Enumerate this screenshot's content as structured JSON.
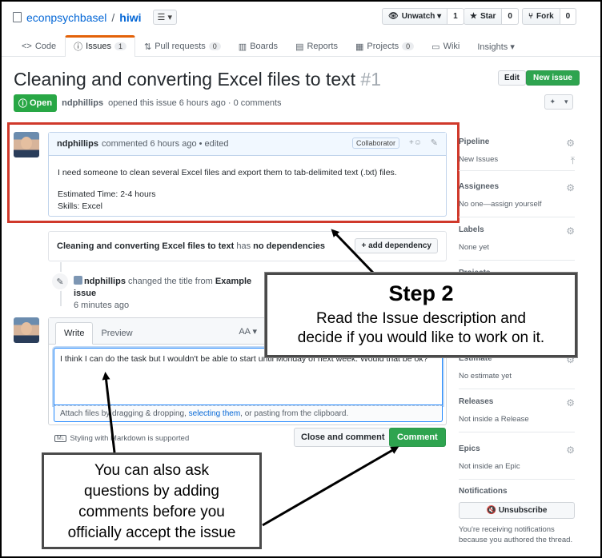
{
  "repo": {
    "owner": "econpsychbasel",
    "separator": "/",
    "name": "hiwi",
    "list_btn": "☰ ▾"
  },
  "actions": [
    {
      "label": "Unwatch ▾",
      "icon": "eye-icon",
      "count": "1"
    },
    {
      "label": "Star",
      "icon": "star-icon",
      "count": "0"
    },
    {
      "label": "Fork",
      "icon": "fork-icon",
      "count": "0"
    }
  ],
  "tabs": [
    {
      "label": "Code",
      "icon": "<>",
      "count": ""
    },
    {
      "label": "Issues",
      "icon": "ⓘ",
      "count": "1"
    },
    {
      "label": "Pull requests",
      "icon": "⇅",
      "count": "0"
    },
    {
      "label": "Boards",
      "icon": "▥",
      "count": ""
    },
    {
      "label": "Reports",
      "icon": "▤",
      "count": ""
    },
    {
      "label": "Projects",
      "icon": "▦",
      "count": "0"
    },
    {
      "label": "Wiki",
      "icon": "▭",
      "count": ""
    },
    {
      "label": "Insights ▾",
      "icon": "",
      "count": ""
    }
  ],
  "issue": {
    "title": "Cleaning and converting Excel files to text",
    "number": "#1",
    "edit": "Edit",
    "new_issue": "New issue",
    "status": "Open",
    "author": "ndphillips",
    "meta": "opened this issue 6 hours ago · 0 comments"
  },
  "comment": {
    "author": "ndphillips",
    "meta": "commented 6 hours ago • edited",
    "badge": "Collaborator",
    "line1": "I need someone to clean several Excel files and export them to tab-delimited text (.txt) files.",
    "line2": "Estimated Time: 2-4 hours",
    "line3": "Skills: Excel"
  },
  "dependency": {
    "title": "Cleaning and converting Excel files to text",
    "has": "has",
    "status": "no dependencies",
    "button": "+ add dependency"
  },
  "event": {
    "author": "ndphillips",
    "text": "changed the title from",
    "from": "Example issue",
    "time": "6 minutes ago"
  },
  "new_comment": {
    "write": "Write",
    "preview": "Preview",
    "aa": "AA ▾",
    "text": "I think I can do the task but I wouldn't be able to start until Monday of next week. Would that be ok?",
    "attach_pre": "Attach files by dragging & dropping,",
    "attach_link": "selecting them",
    "attach_post": ", or pasting from the clipboard.",
    "markdown": "Styling with Markdown is supported",
    "close": "Close and comment",
    "submit": "Comment"
  },
  "sidebar": {
    "pipeline": {
      "title": "Pipeline",
      "value": "New Issues"
    },
    "assignees": {
      "title": "Assignees",
      "value": "No one—assign yourself"
    },
    "labels": {
      "title": "Labels",
      "value": "None yet"
    },
    "projects": {
      "title": "Projects"
    },
    "estimate": {
      "title": "Estimate",
      "value": "No estimate yet"
    },
    "releases": {
      "title": "Releases",
      "value": "Not inside a Release"
    },
    "epics": {
      "title": "Epics",
      "value": "Not inside an Epic"
    },
    "notifications": {
      "title": "Notifications",
      "button": "🔇 Unsubscribe",
      "note": "You're receiving notifications because you authored the thread."
    }
  },
  "callouts": {
    "step2_title": "Step 2",
    "step2_line1": "Read the Issue description and",
    "step2_line2": "decide if you would like to work on it.",
    "ask_line1": "You can also ask",
    "ask_line2": "questions by adding",
    "ask_line3": "comments before you",
    "ask_line4": "officially accept the issue"
  }
}
